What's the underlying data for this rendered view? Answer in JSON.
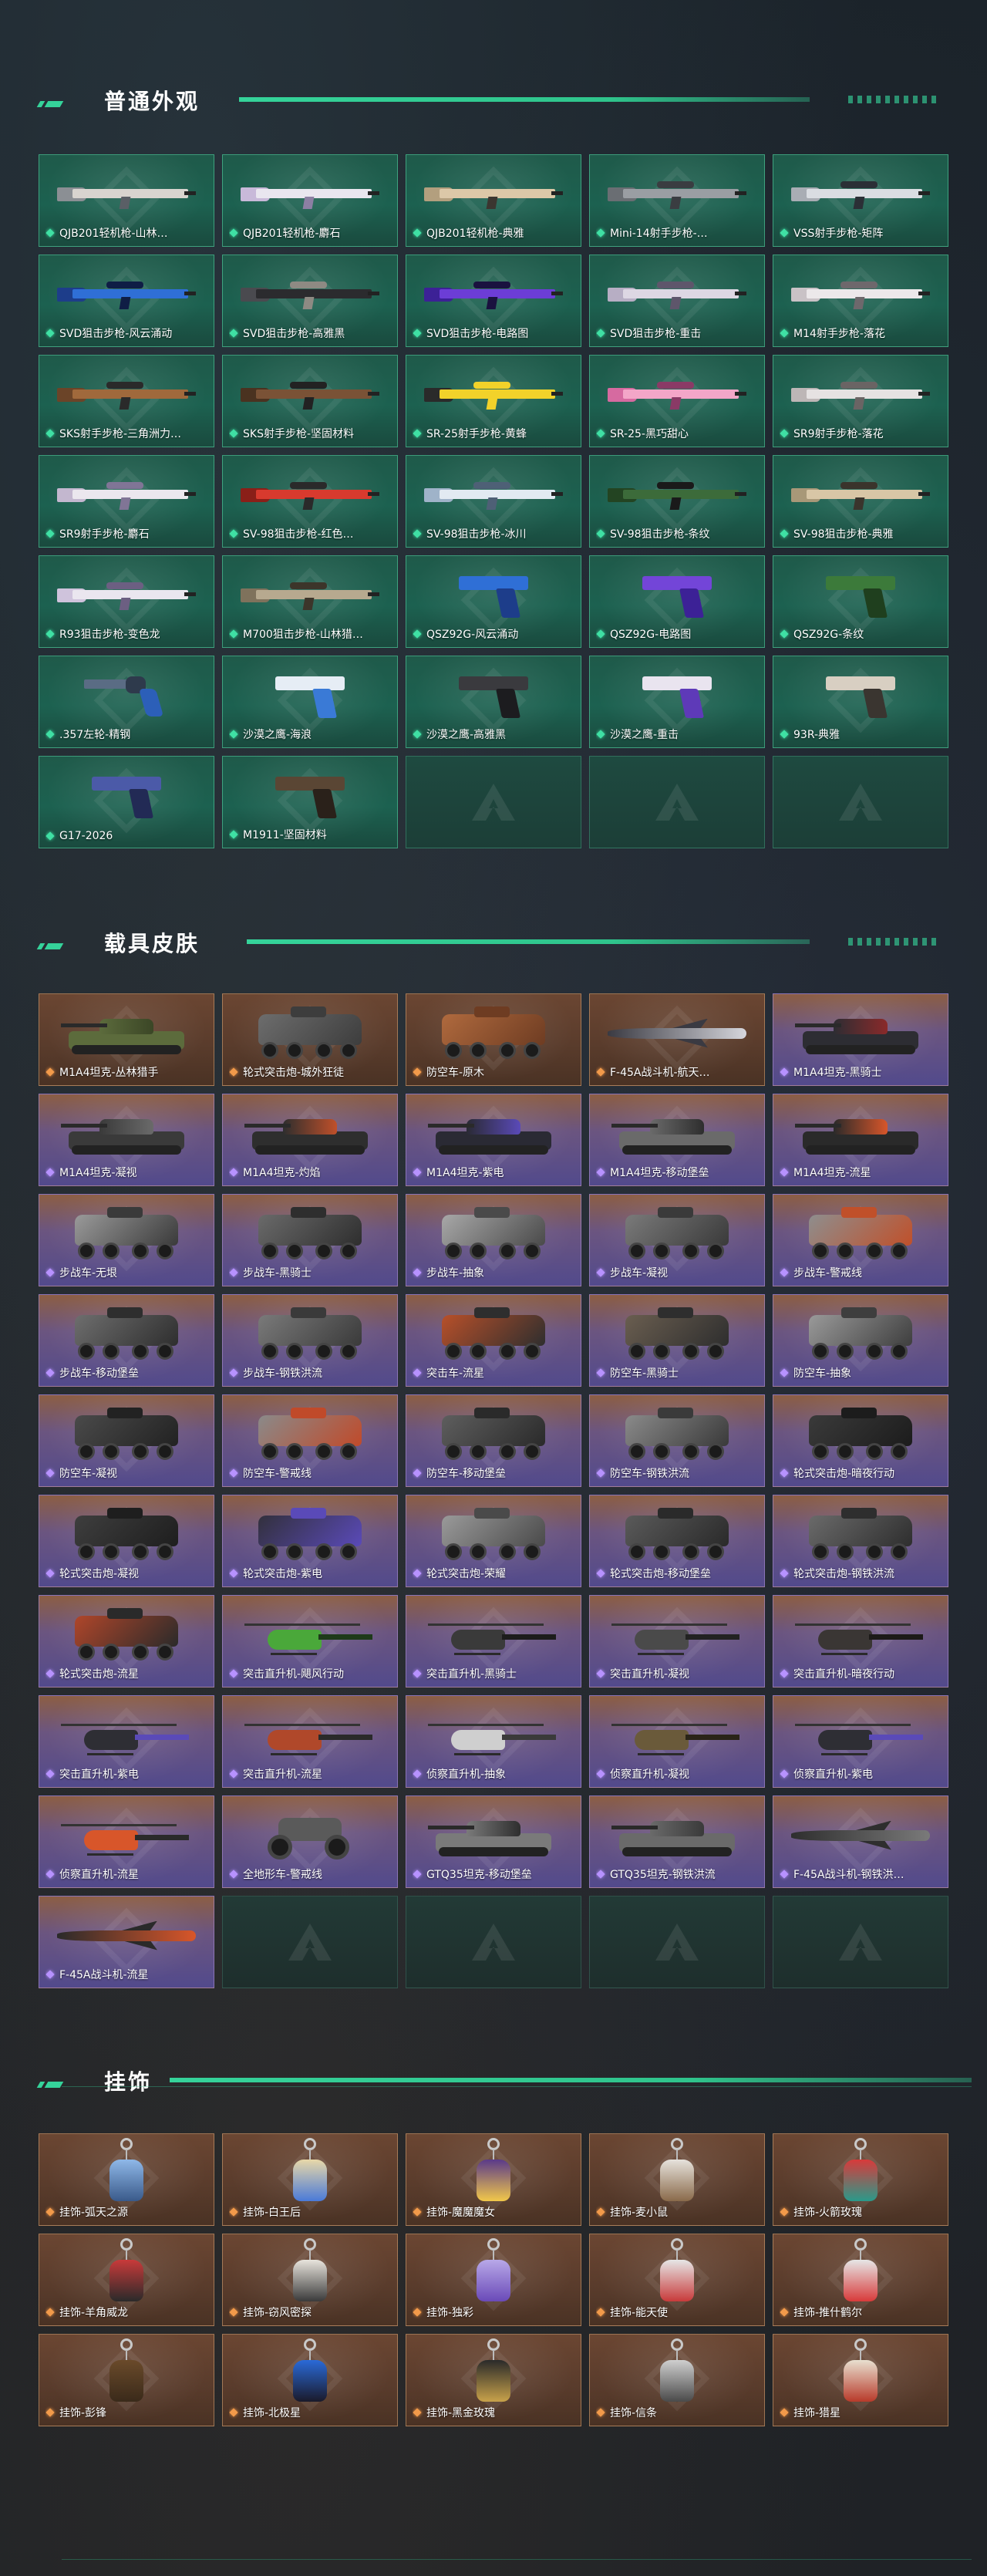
{
  "colors": {
    "accent": "#35d39a",
    "green_card": "#1c6150",
    "purple_card": "#524a8c",
    "brown_card": "#5a3c2c",
    "page_bg": "#1c2228"
  },
  "sections": {
    "weapons": {
      "title": "普通外观",
      "items": [
        {
          "label": "QJB201轻机枪-山林…",
          "icon": "machine-gun",
          "scheme": [
            "#d8d4cf",
            "#8b8f94",
            "#5a5f66"
          ]
        },
        {
          "label": "QJB201轻机枪-麝石",
          "icon": "machine-gun",
          "scheme": [
            "#e9e6ef",
            "#c8b9d9",
            "#8c7fa3"
          ]
        },
        {
          "label": "QJB201轻机枪-典雅",
          "icon": "machine-gun",
          "scheme": [
            "#dcc8a8",
            "#b39f7e",
            "#3b3630"
          ]
        },
        {
          "label": "Mini-14射手步枪-…",
          "icon": "rifle",
          "scheme": [
            "#9a9ea3",
            "#6a6e73",
            "#3a3d41"
          ]
        },
        {
          "label": "VSS射手步枪-矩阵",
          "icon": "rifle",
          "scheme": [
            "#dadde2",
            "#a9adb4",
            "#2b2f36"
          ]
        },
        {
          "label": "SVD狙击步枪-风云涌动",
          "icon": "sniper",
          "scheme": [
            "#2f6fd6",
            "#1d3d8a",
            "#0f1d45"
          ]
        },
        {
          "label": "SVD狙击步枪-高雅黑",
          "icon": "sniper",
          "scheme": [
            "#2b2b2e",
            "#4a4a4f",
            "#8e8a83"
          ]
        },
        {
          "label": "SVD狙击步枪-电路图",
          "icon": "sniper",
          "scheme": [
            "#6c3dd6",
            "#3c2196",
            "#1a123f"
          ]
        },
        {
          "label": "SVD狙击步枪-重击",
          "icon": "sniper",
          "scheme": [
            "#ddd7e3",
            "#b7aec4",
            "#5e566b"
          ]
        },
        {
          "label": "M14射手步枪-落花",
          "icon": "rifle",
          "scheme": [
            "#ece8ea",
            "#c9c2c6",
            "#6e686c"
          ]
        },
        {
          "label": "SKS射手步枪-三角洲力…",
          "icon": "rifle",
          "scheme": [
            "#a0693c",
            "#6b4428",
            "#2a2a2a"
          ]
        },
        {
          "label": "SKS射手步枪-坚固材料",
          "icon": "rifle",
          "scheme": [
            "#7a5236",
            "#4a3220",
            "#222222"
          ]
        },
        {
          "label": "SR-25射手步枪-黄蜂",
          "icon": "rifle",
          "scheme": [
            "#f2d22a",
            "#2a2a2a",
            "#f2d22a"
          ]
        },
        {
          "label": "SR-25-黑巧甜心",
          "icon": "rifle",
          "scheme": [
            "#f3a6c8",
            "#d66aa0",
            "#8a3a66"
          ]
        },
        {
          "label": "SR9射手步枪-落花",
          "icon": "rifle",
          "scheme": [
            "#e6e2e2",
            "#bdb6b6",
            "#6a6464"
          ]
        },
        {
          "label": "SR9射手步枪-麝石",
          "icon": "rifle",
          "scheme": [
            "#ebe7ee",
            "#c3b7cf",
            "#807596"
          ]
        },
        {
          "label": "SV-98狙击步枪-红色…",
          "icon": "sniper",
          "scheme": [
            "#d83a2e",
            "#8a1f18",
            "#2a2a2a"
          ]
        },
        {
          "label": "SV-98狙击步枪-冰川",
          "icon": "sniper",
          "scheme": [
            "#e2eaf2",
            "#9fb3c9",
            "#4e6076"
          ]
        },
        {
          "label": "SV-98狙击步枪-条纹",
          "icon": "sniper",
          "scheme": [
            "#3c6b3a",
            "#234422",
            "#1a1a1a"
          ]
        },
        {
          "label": "SV-98狙击步枪-典雅",
          "icon": "sniper",
          "scheme": [
            "#d8c6a6",
            "#a89878",
            "#3a342c"
          ]
        },
        {
          "label": "R93狙击步枪-变色龙",
          "icon": "sniper",
          "scheme": [
            "#eae6ef",
            "#cfc3dc",
            "#6c5f82"
          ]
        },
        {
          "label": "M700狙击步枪-山林猎…",
          "icon": "sniper",
          "scheme": [
            "#b7a98f",
            "#7f725c",
            "#3c352a"
          ]
        },
        {
          "label": "QSZ92G-风云涌动",
          "icon": "pistol",
          "scheme": [
            "#2f6fd6",
            "#1d3d8a"
          ]
        },
        {
          "label": "QSZ92G-电路图",
          "icon": "pistol",
          "scheme": [
            "#7345d8",
            "#3c2196"
          ]
        },
        {
          "label": "QSZ92G-条纹",
          "icon": "pistol",
          "scheme": [
            "#3c7a3a",
            "#1f3f1e"
          ]
        },
        {
          "label": ".357左轮-精钢",
          "icon": "revolver",
          "scheme": [
            "#5a6c84",
            "#2e3a4c",
            "#2c5fb8"
          ]
        },
        {
          "label": "沙漠之鹰-海浪",
          "icon": "pistol",
          "scheme": [
            "#e6edf5",
            "#3a7ad6"
          ]
        },
        {
          "label": "沙漠之鹰-高雅黑",
          "icon": "pistol",
          "scheme": [
            "#3a3a3e",
            "#1c1c1f"
          ]
        },
        {
          "label": "沙漠之鹰-重击",
          "icon": "pistol",
          "scheme": [
            "#e9e4ef",
            "#5e3ab8"
          ]
        },
        {
          "label": "93R-典雅",
          "icon": "pistol",
          "scheme": [
            "#d8cfc2",
            "#3a3530"
          ]
        },
        {
          "label": "G17-2026",
          "icon": "pistol",
          "scheme": [
            "#4b5aa8",
            "#222a55"
          ]
        },
        {
          "label": "M1911-坚固材料",
          "icon": "pistol",
          "scheme": [
            "#5a4634",
            "#2a211a"
          ]
        }
      ]
    },
    "vehicles": {
      "title": "载具皮肤",
      "items": [
        {
          "label": "M1A4坦克-丛林猎手",
          "icon": "tank",
          "scheme": [
            "#5c6b3c",
            "#3b4626"
          ],
          "card": "brown"
        },
        {
          "label": "轮式突击炮-城外狂徒",
          "icon": "apc",
          "scheme": [
            "#6d6d6d",
            "#3d3d3d"
          ],
          "card": "brown"
        },
        {
          "label": "防空车-原木",
          "icon": "apc",
          "scheme": [
            "#b06a3e",
            "#6e3c22"
          ],
          "card": "brown"
        },
        {
          "label": "F-45A战斗机-航天…",
          "icon": "jet",
          "scheme": [
            "#d6d6dc",
            "#3a3a42"
          ],
          "card": "brown"
        },
        {
          "label": "M1A4坦克-黑骑士",
          "icon": "tank",
          "scheme": [
            "#2d2d33",
            "#8a2a2a"
          ],
          "card": "purple"
        },
        {
          "label": "M1A4坦克-凝视",
          "icon": "tank",
          "scheme": [
            "#3a3a3a",
            "#6a6a6a"
          ],
          "card": "purple"
        },
        {
          "label": "M1A4坦克-灼焰",
          "icon": "tank",
          "scheme": [
            "#2e2e2e",
            "#c0502a"
          ],
          "card": "purple"
        },
        {
          "label": "M1A4坦克-紫电",
          "icon": "tank",
          "scheme": [
            "#2a2a34",
            "#5a4ab8"
          ],
          "card": "purple"
        },
        {
          "label": "M1A4坦克-移动堡垒",
          "icon": "tank",
          "scheme": [
            "#6a6a6a",
            "#2e2e2e"
          ],
          "card": "purple"
        },
        {
          "label": "M1A4坦克-流星",
          "icon": "tank",
          "scheme": [
            "#2a2a2a",
            "#d8562a"
          ],
          "card": "purple"
        },
        {
          "label": "步战车-无垠",
          "icon": "apc",
          "scheme": [
            "#9a9a9a",
            "#3a3a3a"
          ],
          "card": "purple"
        },
        {
          "label": "步战车-黑骑士",
          "icon": "apc",
          "scheme": [
            "#6a6a6a",
            "#2e2e2e"
          ],
          "card": "purple"
        },
        {
          "label": "步战车-抽象",
          "icon": "apc",
          "scheme": [
            "#a8a8a8",
            "#4a4a4a"
          ],
          "card": "purple"
        },
        {
          "label": "步战车-凝视",
          "icon": "apc",
          "scheme": [
            "#7a7a7a",
            "#3a3a3a"
          ],
          "card": "purple"
        },
        {
          "label": "步战车-警戒线",
          "icon": "apc",
          "scheme": [
            "#8e8e8e",
            "#c0502a"
          ],
          "card": "purple"
        },
        {
          "label": "步战车-移动堡垒",
          "icon": "apc",
          "scheme": [
            "#6e6e6e",
            "#2e2e2e"
          ],
          "card": "purple"
        },
        {
          "label": "步战车-钢铁洪流",
          "icon": "apc",
          "scheme": [
            "#7a7a7a",
            "#3a3a3a"
          ],
          "card": "purple"
        },
        {
          "label": "突击车-流星",
          "icon": "apc",
          "scheme": [
            "#b8502a",
            "#2e2e2e"
          ],
          "card": "purple"
        },
        {
          "label": "防空车-黑骑士",
          "icon": "apc",
          "scheme": [
            "#6a5e50",
            "#2e2e2e"
          ],
          "card": "purple"
        },
        {
          "label": "防空车-抽象",
          "icon": "apc",
          "scheme": [
            "#9a9a9a",
            "#3e3e3e"
          ],
          "card": "purple"
        },
        {
          "label": "防空车-凝视",
          "icon": "apc",
          "scheme": [
            "#4a4a4a",
            "#222222"
          ],
          "card": "purple"
        },
        {
          "label": "防空车-警戒线",
          "icon": "apc",
          "scheme": [
            "#8a8a8a",
            "#c04a2a"
          ],
          "card": "purple"
        },
        {
          "label": "防空车-移动堡垒",
          "icon": "apc",
          "scheme": [
            "#5e5e5e",
            "#2a2a2a"
          ],
          "card": "purple"
        },
        {
          "label": "防空车-钢铁洪流",
          "icon": "apc",
          "scheme": [
            "#8a8a8a",
            "#3a3a3a"
          ],
          "card": "purple"
        },
        {
          "label": "轮式突击炮-暗夜行动",
          "icon": "apc",
          "scheme": [
            "#3a3a3a",
            "#1c1c1c"
          ],
          "card": "purple"
        },
        {
          "label": "轮式突击炮-凝视",
          "icon": "apc",
          "scheme": [
            "#3e3e3e",
            "#1e1e1e"
          ],
          "card": "purple"
        },
        {
          "label": "轮式突击炮-紫电",
          "icon": "apc",
          "scheme": [
            "#32303c",
            "#5a4ab8"
          ],
          "card": "purple"
        },
        {
          "label": "轮式突击炮-荣耀",
          "icon": "apc",
          "scheme": [
            "#9a9a9a",
            "#4a4a4a"
          ],
          "card": "purple"
        },
        {
          "label": "轮式突击炮-移动堡垒",
          "icon": "apc",
          "scheme": [
            "#5a5a5a",
            "#2a2a2a"
          ],
          "card": "purple"
        },
        {
          "label": "轮式突击炮-钢铁洪流",
          "icon": "apc",
          "scheme": [
            "#6a6a6a",
            "#2e2e2e"
          ],
          "card": "purple"
        },
        {
          "label": "轮式突击炮-流星",
          "icon": "apc",
          "scheme": [
            "#b0462a",
            "#2a2a2a"
          ],
          "card": "purple"
        },
        {
          "label": "突击直升机-飓风行动",
          "icon": "heli",
          "scheme": [
            "#4aa83a",
            "#1e3a1a"
          ],
          "card": "purple"
        },
        {
          "label": "突击直升机-黑骑士",
          "icon": "heli",
          "scheme": [
            "#3a3a3a",
            "#1c1c1c"
          ],
          "card": "purple"
        },
        {
          "label": "突击直升机-凝视",
          "icon": "heli",
          "scheme": [
            "#4a4a4a",
            "#222222"
          ],
          "card": "purple"
        },
        {
          "label": "突击直升机-暗夜行动",
          "icon": "heli",
          "scheme": [
            "#3a3634",
            "#1c1a18"
          ],
          "card": "purple"
        },
        {
          "label": "突击直升机-紫电",
          "icon": "heli",
          "scheme": [
            "#2e2e34",
            "#5a4ab8"
          ],
          "card": "purple"
        },
        {
          "label": "突击直升机-流星",
          "icon": "heli",
          "scheme": [
            "#b0482a",
            "#2a2a2a"
          ],
          "card": "purple"
        },
        {
          "label": "侦察直升机-抽象",
          "icon": "heli",
          "scheme": [
            "#cfcfcf",
            "#3a3a3a"
          ],
          "card": "purple"
        },
        {
          "label": "侦察直升机-凝视",
          "icon": "heli",
          "scheme": [
            "#6a5a3a",
            "#2a2418"
          ],
          "card": "purple"
        },
        {
          "label": "侦察直升机-紫电",
          "icon": "heli",
          "scheme": [
            "#2e2e34",
            "#5a4ab8"
          ],
          "card": "purple"
        },
        {
          "label": "侦察直升机-流星",
          "icon": "heli",
          "scheme": [
            "#d8562a",
            "#2a2a2a"
          ],
          "card": "purple"
        },
        {
          "label": "全地形车-警戒线",
          "icon": "atv",
          "scheme": [
            "#5a5a5a",
            "#c04a2a"
          ],
          "card": "purple"
        },
        {
          "label": "GTQ35坦克-移动堡垒",
          "icon": "tank",
          "scheme": [
            "#7a7a7a",
            "#2e2e2e"
          ],
          "card": "purple"
        },
        {
          "label": "GTQ35坦克-钢铁洪流",
          "icon": "tank",
          "scheme": [
            "#6a6a6a",
            "#3a3a3a"
          ],
          "card": "purple"
        },
        {
          "label": "F-45A战斗机-钢铁洪…",
          "icon": "jet",
          "scheme": [
            "#7a7a7a",
            "#2e2e2e"
          ],
          "card": "purple"
        },
        {
          "label": "F-45A战斗机-流星",
          "icon": "jet",
          "scheme": [
            "#d8562a",
            "#2a2a2a"
          ],
          "card": "purple"
        }
      ]
    },
    "charms": {
      "title": "挂饰",
      "items": [
        {
          "label": "挂饰-弧天之源",
          "scheme": [
            "#8fb8e8",
            "#3a5a8a"
          ]
        },
        {
          "label": "挂饰-白王后",
          "scheme": [
            "#e8d8a8",
            "#4a7ad8"
          ]
        },
        {
          "label": "挂饰-魔魔魔女",
          "scheme": [
            "#5a3a8a",
            "#f2c84a"
          ]
        },
        {
          "label": "挂饰-麦小鼠",
          "scheme": [
            "#e6e2dc",
            "#8a6a4a"
          ]
        },
        {
          "label": "挂饰-火箭玫瑰",
          "scheme": [
            "#d83a3a",
            "#2a9a8a"
          ]
        },
        {
          "label": "挂饰-羊角威龙",
          "scheme": [
            "#c83a3a",
            "#2a2a2a"
          ]
        },
        {
          "label": "挂饰-窃风密探",
          "scheme": [
            "#e8e4dc",
            "#3a3a3a"
          ]
        },
        {
          "label": "挂饰-独彩",
          "scheme": [
            "#b8a8e8",
            "#6a4ab8"
          ]
        },
        {
          "label": "挂饰-能天使",
          "scheme": [
            "#e6e6e6",
            "#c83a3a"
          ]
        },
        {
          "label": "挂饰-推什鹤尔",
          "scheme": [
            "#e6e6e6",
            "#d83a3a"
          ]
        },
        {
          "label": "挂饰-彭锋",
          "scheme": [
            "#6a4a2a",
            "#3a2a1a"
          ]
        },
        {
          "label": "挂饰-北极星",
          "scheme": [
            "#2a6ad8",
            "#1a1a2a"
          ]
        },
        {
          "label": "挂饰-黑金玫瑰",
          "scheme": [
            "#2a2a2a",
            "#c8a24a"
          ]
        },
        {
          "label": "挂饰-信条",
          "scheme": [
            "#cfcfcf",
            "#4a4a4a"
          ]
        },
        {
          "label": "挂饰-猎星",
          "scheme": [
            "#e8e0d0",
            "#b83a2a"
          ]
        }
      ]
    }
  }
}
